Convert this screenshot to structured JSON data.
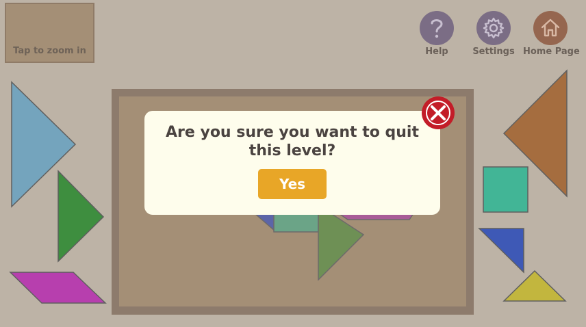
{
  "zoom": {
    "label": "Tap to zoom in"
  },
  "toolbar": {
    "help": {
      "label": "Help",
      "icon": "question-icon",
      "color": "#7b6d85"
    },
    "settings": {
      "label": "Settings",
      "icon": "gear-icon",
      "color": "#7b6d85"
    },
    "home": {
      "label": "Home Page",
      "icon": "home-icon",
      "color": "#95664f"
    }
  },
  "dialog": {
    "message": "Are you sure you want to quit this level?",
    "yes_label": "Yes",
    "close_icon": "close-icon",
    "close_color": "#c31d28",
    "yes_color": "#e8a627"
  },
  "pieces": {
    "large_triangle_blue": "#74a4bd",
    "medium_triangle_green": "#3e8e3f",
    "parallelogram_magenta": "#b73fae",
    "large_triangle_brown": "#a56d3f",
    "square_teal": "#42b596",
    "small_triangle_blue": "#3e59b6",
    "small_triangle_yellow": "#c2b63e"
  }
}
